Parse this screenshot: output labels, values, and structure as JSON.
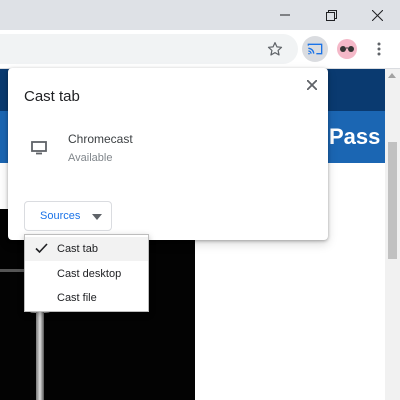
{
  "window_controls": {
    "minimize_icon": "minimize-icon",
    "restore_icon": "restore-icon",
    "close_icon": "close-icon"
  },
  "toolbar": {
    "icons": [
      "star-icon",
      "cast-icon",
      "profile-avatar-icon",
      "kebab-menu-icon"
    ]
  },
  "page": {
    "banner_text": "Pass"
  },
  "cast_dialog": {
    "title": "Cast tab",
    "close_icon": "close-icon",
    "sinks": [
      {
        "name": "Chromecast",
        "status": "Available",
        "icon": "monitor-icon"
      }
    ],
    "sources_button_label": "Sources"
  },
  "sources_menu": {
    "items": [
      {
        "label": "Cast tab",
        "checked": true
      },
      {
        "label": "Cast desktop",
        "checked": false
      },
      {
        "label": "Cast file",
        "checked": false
      }
    ]
  },
  "colors": {
    "accent": "#1a73e8",
    "titlebar": "#dee1e6",
    "site_navy": "#0a3a70",
    "site_blue": "#1b66b3"
  }
}
